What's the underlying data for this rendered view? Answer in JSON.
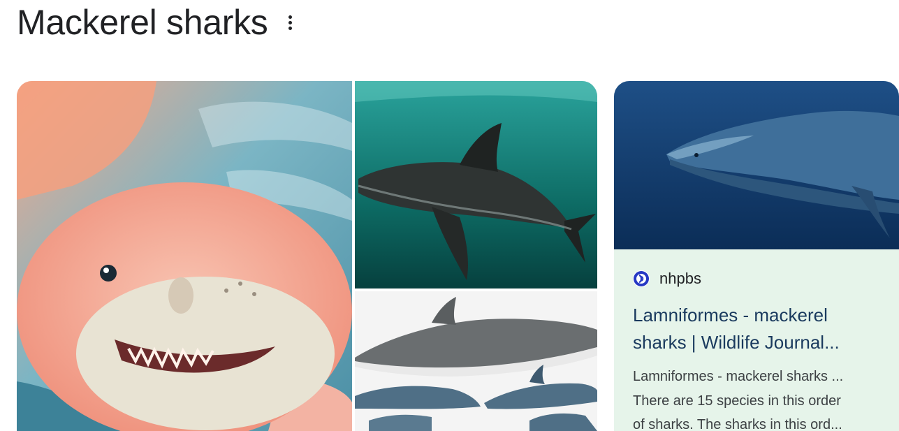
{
  "header": {
    "title": "Mackerel sharks",
    "more_icon": "more-vert-icon"
  },
  "images": [
    {
      "id": "pink-furry-shark",
      "subject": "pink furry shark illustration"
    },
    {
      "id": "great-white-teal",
      "subject": "shark swimming in teal water"
    },
    {
      "id": "sharks-white-bg",
      "subject": "several sharks on white background"
    }
  ],
  "card": {
    "source": "nhpbs",
    "favicon": "pbs-logo-icon",
    "title_line1": "Lamniformes - mackerel",
    "title_line2": "sharks | Wildlife Journal...",
    "snippet_line1": "Lamniformes - mackerel sharks ...",
    "snippet_line2": "There are 15 species in this order",
    "snippet_line3": "of sharks. The sharks in this ord...",
    "background": "#e6f4ea"
  }
}
